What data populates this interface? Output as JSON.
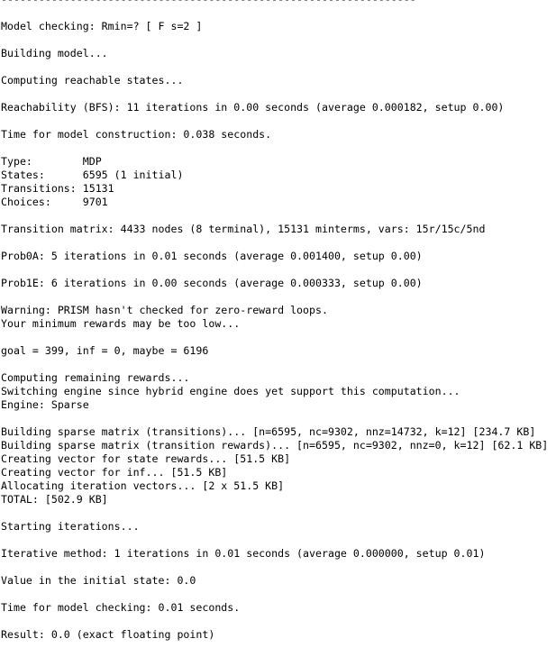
{
  "console": {
    "lines": [
      "------------------------------------------------------------------",
      "",
      "Model checking: Rmin=? [ F s=2 ]",
      "",
      "Building model...",
      "",
      "Computing reachable states...",
      "",
      "Reachability (BFS): 11 iterations in 0.00 seconds (average 0.000182, setup 0.00)",
      "",
      "Time for model construction: 0.038 seconds.",
      "",
      "Type:        MDP",
      "States:      6595 (1 initial)",
      "Transitions: 15131",
      "Choices:     9701",
      "",
      "Transition matrix: 4433 nodes (8 terminal), 15131 minterms, vars: 15r/15c/5nd",
      "",
      "Prob0A: 5 iterations in 0.01 seconds (average 0.001400, setup 0.00)",
      "",
      "Prob1E: 6 iterations in 0.00 seconds (average 0.000333, setup 0.00)",
      "",
      "Warning: PRISM hasn't checked for zero-reward loops.",
      "Your minimum rewards may be too low...",
      "",
      "goal = 399, inf = 0, maybe = 6196",
      "",
      "Computing remaining rewards...",
      "Switching engine since hybrid engine does yet support this computation...",
      "Engine: Sparse",
      "",
      "Building sparse matrix (transitions)... [n=6595, nc=9302, nnz=14732, k=12] [234.7 KB]",
      "Building sparse matrix (transition rewards)... [n=6595, nc=9302, nnz=0, k=12] [62.1 KB]",
      "Creating vector for state rewards... [51.5 KB]",
      "Creating vector for inf... [51.5 KB]",
      "Allocating iteration vectors... [2 x 51.5 KB]",
      "TOTAL: [502.9 KB]",
      "",
      "Starting iterations...",
      "",
      "Iterative method: 1 iterations in 0.01 seconds (average 0.000000, setup 0.01)",
      "",
      "Value in the initial state: 0.0",
      "",
      "Time for model checking: 0.01 seconds.",
      "",
      "Result: 0.0 (exact floating point)"
    ]
  }
}
